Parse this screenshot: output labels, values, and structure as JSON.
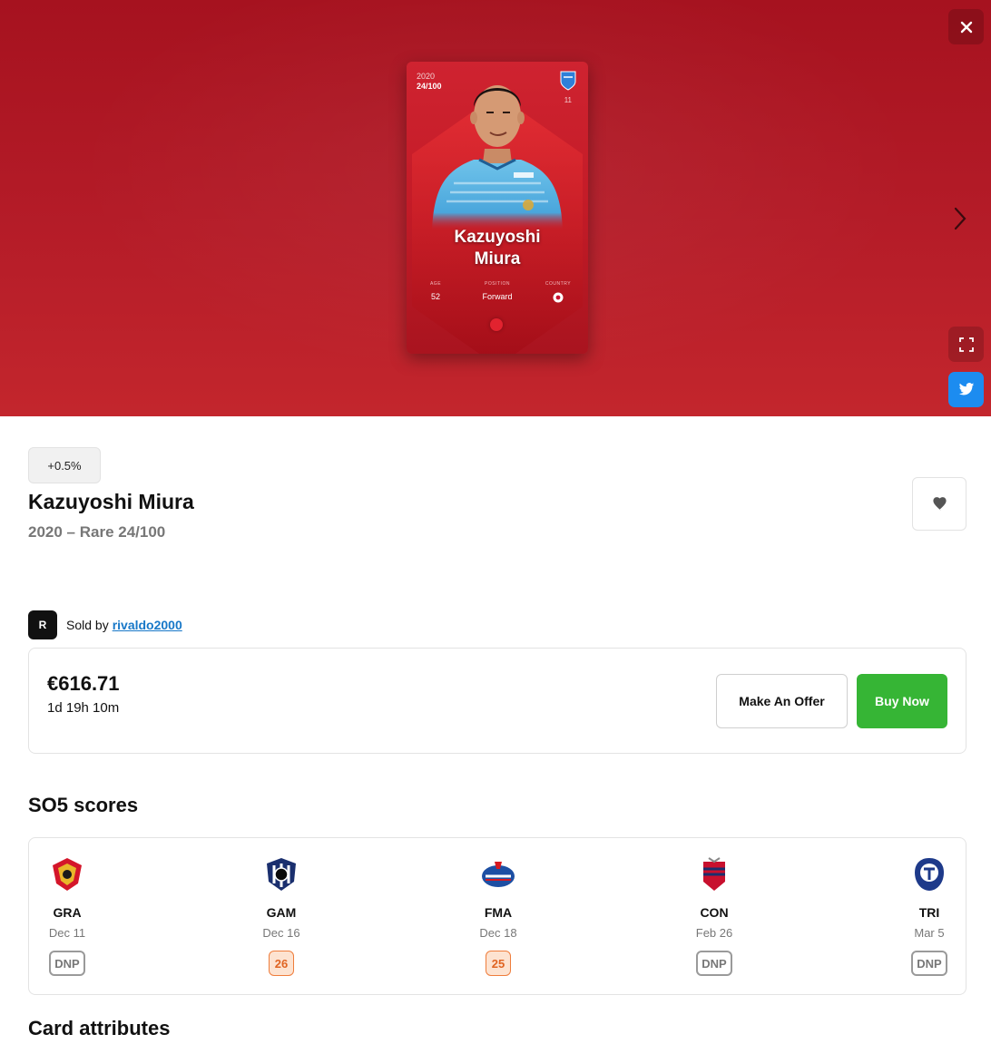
{
  "hero": {
    "card": {
      "season": "2020",
      "serial": "24/100",
      "number": "11",
      "name_line1": "Kazuyoshi",
      "name_line2": "Miura",
      "age_label": "AGE",
      "age": "52",
      "position_label": "POSITION",
      "position": "Forward",
      "country_label": "COUNTRY"
    },
    "icons": {
      "close": "close-icon",
      "next": "chevron-right-icon",
      "expand": "expand-icon",
      "share": "twitter-icon"
    },
    "colors": {
      "background": "#b51c28",
      "twitter": "#1c8cf0"
    }
  },
  "info": {
    "trend": "+0.5%",
    "player_name": "Kazuyoshi Miura",
    "subtitle": "2020 – Rare 24/100"
  },
  "seller": {
    "avatar_letter": "R",
    "prefix": "Sold by",
    "username": "rivaldo2000"
  },
  "listing": {
    "price": "€616.71",
    "time_left": "1d 19h 10m",
    "offer_label": "Make An Offer",
    "buy_label": "Buy Now",
    "buy_color": "#36b535"
  },
  "so5": {
    "title": "SO5 scores",
    "matches": [
      {
        "team": "GRA",
        "date": "Dec 11",
        "score": "DNP"
      },
      {
        "team": "GAM",
        "date": "Dec 16",
        "score": "26"
      },
      {
        "team": "FMA",
        "date": "Dec 18",
        "score": "25"
      },
      {
        "team": "CON",
        "date": "Feb 26",
        "score": "DNP"
      },
      {
        "team": "TRI",
        "date": "Mar 5",
        "score": "DNP"
      }
    ]
  },
  "attributes": {
    "title": "Card attributes"
  }
}
